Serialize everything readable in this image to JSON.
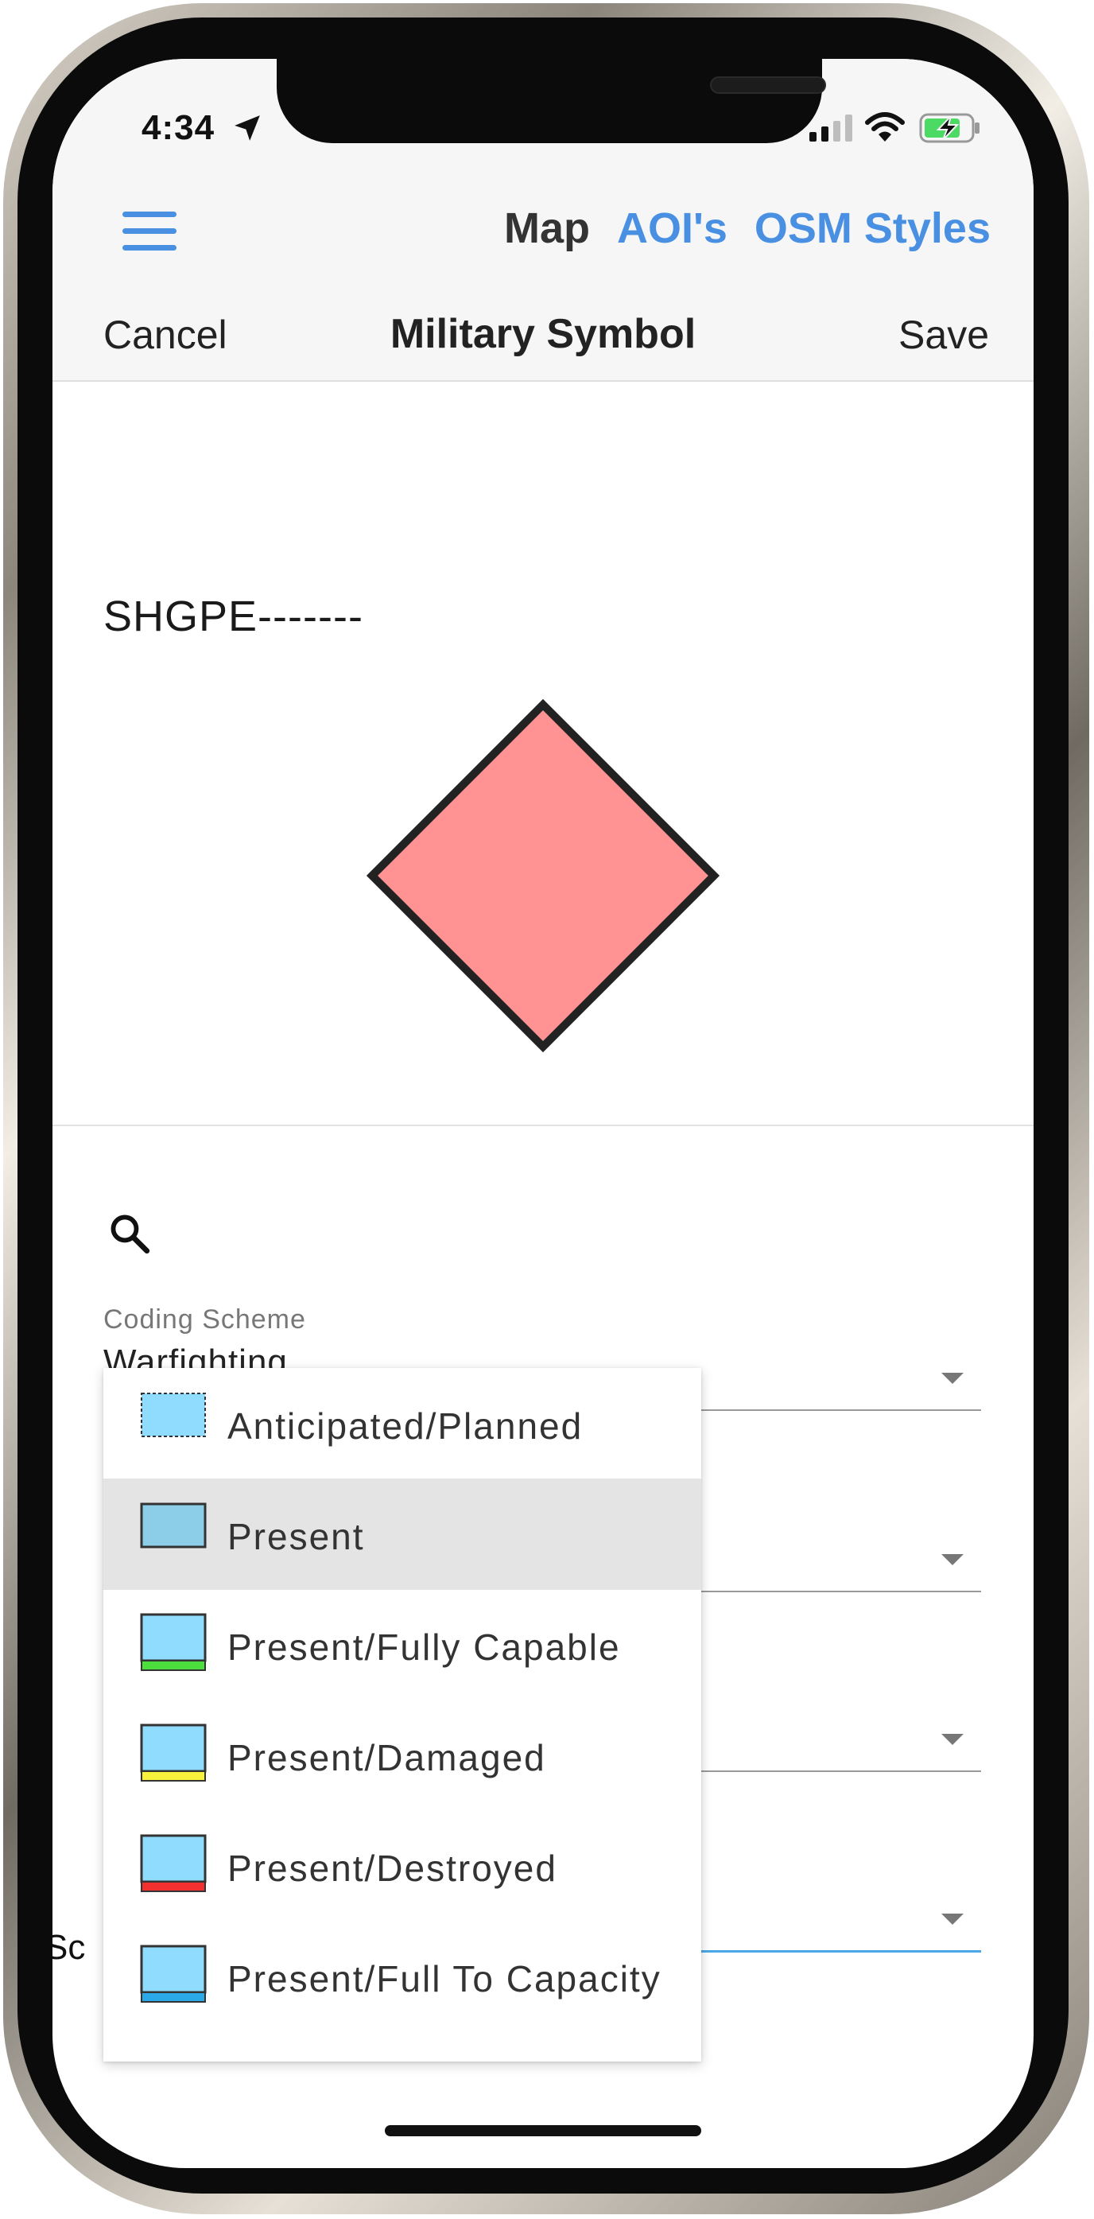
{
  "status_bar": {
    "time": "4:34"
  },
  "nav": {
    "links": [
      "Map",
      "AOI's",
      "OSM Styles"
    ]
  },
  "toolbar": {
    "cancel_label": "Cancel",
    "title": "Military Symbol",
    "save_label": "Save"
  },
  "symbol": {
    "code": "SHGPE-------",
    "fill_color": "#ff9292",
    "stroke_color": "#222222"
  },
  "form": {
    "coding_scheme_label": "Coding Scheme",
    "coding_scheme_value": "Warfighting",
    "partial_label": "Sc"
  },
  "status_menu": {
    "selected_index": 1,
    "options": [
      {
        "label": "Anticipated/Planned",
        "fill": "#8fdcff",
        "bar": null,
        "dashed": true
      },
      {
        "label": "Present",
        "fill": "#8ccde8",
        "bar": null,
        "dashed": false
      },
      {
        "label": "Present/Fully Capable",
        "fill": "#8fdcff",
        "bar": "#4cde3c",
        "dashed": false
      },
      {
        "label": "Present/Damaged",
        "fill": "#8fdcff",
        "bar": "#f8f23c",
        "dashed": false
      },
      {
        "label": "Present/Destroyed",
        "fill": "#8fdcff",
        "bar": "#f23030",
        "dashed": false
      },
      {
        "label": "Present/Full To Capacity",
        "fill": "#8fdcff",
        "bar": "#2aa8e8",
        "dashed": false
      }
    ]
  },
  "colors": {
    "accent": "#4a90e2",
    "active_underline": "#4aa8e8"
  }
}
